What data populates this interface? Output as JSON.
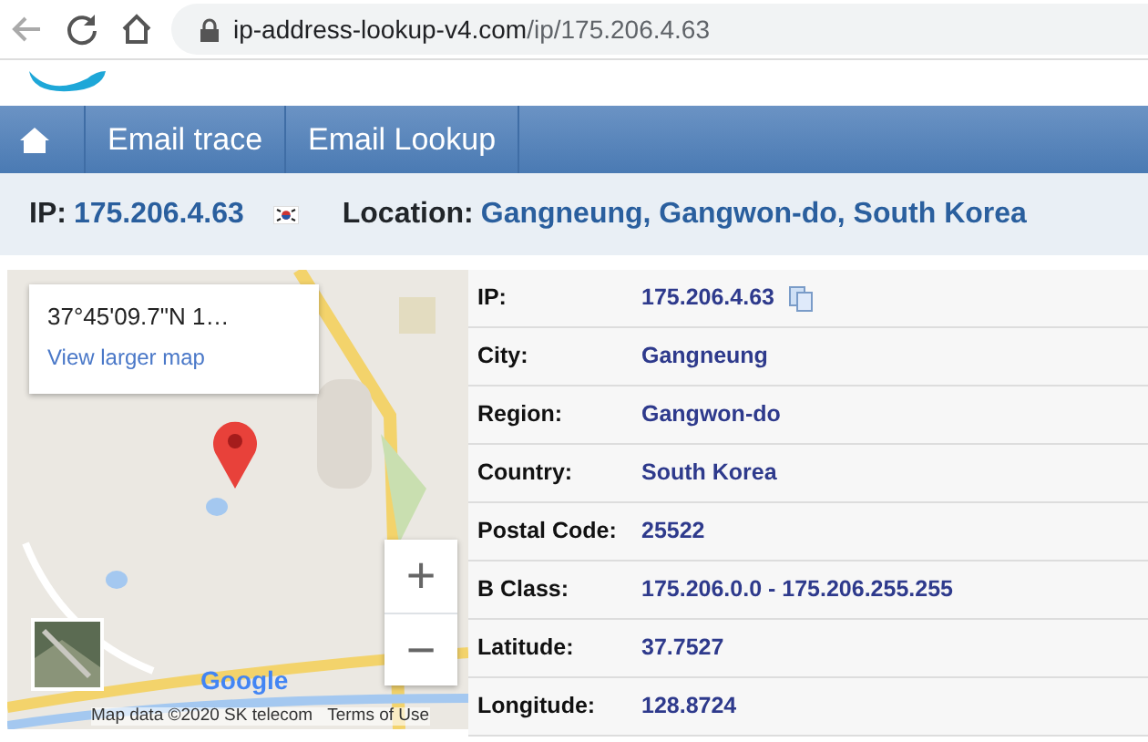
{
  "browser": {
    "url_host": "ip-address-lookup-v4.com",
    "url_path": "/ip/175.206.4.63",
    "back_disabled": true
  },
  "nav": {
    "items": [
      {
        "kind": "home"
      },
      {
        "kind": "link",
        "label": "Email trace"
      },
      {
        "kind": "link",
        "label": "Email Lookup"
      }
    ]
  },
  "summary": {
    "ip_label": "IP:",
    "ip": "175.206.4.63",
    "location_label": "Location:",
    "location": "Gangneung, Gangwon-do, South Korea"
  },
  "map": {
    "coords": "37°45'09.7\"N 1…",
    "larger_link": "View larger map",
    "logo": "Google",
    "attribution": "Map data ©2020 SK telecom",
    "terms": "Terms of Use",
    "zoom_in": "+",
    "zoom_out": "−"
  },
  "details": [
    {
      "label": "IP:",
      "value": "175.206.4.63",
      "copy": true
    },
    {
      "label": "City:",
      "value": "Gangneung"
    },
    {
      "label": "Region:",
      "value": "Gangwon-do"
    },
    {
      "label": "Country:",
      "value": "South Korea"
    },
    {
      "label": "Postal Code:",
      "value": "25522"
    },
    {
      "label": "B Class:",
      "value": "175.206.0.0 - 175.206.255.255"
    },
    {
      "label": "Latitude:",
      "value": "37.7527"
    },
    {
      "label": "Longitude:",
      "value": "128.8724"
    }
  ]
}
